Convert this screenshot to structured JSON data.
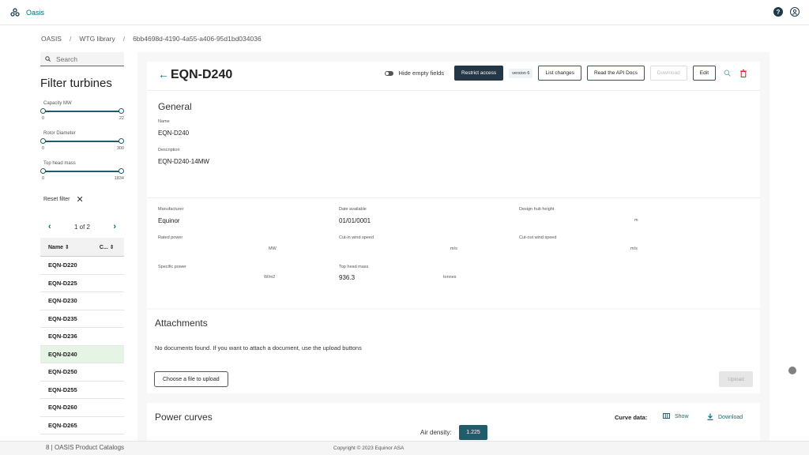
{
  "app": {
    "title": "Oasis"
  },
  "breadcrumb": [
    "OASIS",
    "WTG library",
    "6bb4698d-4190-4a55-a406-95d1bd034036"
  ],
  "breadcrumb_separator": "/",
  "sidebar": {
    "search_placeholder": "Search",
    "filter_title": "Filter turbines",
    "sliders": [
      {
        "label": "Capacity MW",
        "min": "0",
        "max": "22"
      },
      {
        "label": "Rotor Diameter",
        "min": "0",
        "max": "300"
      },
      {
        "label": "Top head mass",
        "min": "0",
        "max": "1834"
      }
    ],
    "reset_label": "Reset filter",
    "pager": "1 of 2",
    "columns": [
      "Name",
      "C..."
    ],
    "items": [
      "EQN-D220",
      "EQN-D225",
      "EQN-D230",
      "EQN-D235",
      "EQN-D236",
      "EQN-D240",
      "EQN-D250",
      "EQN-D255",
      "EQN-D260",
      "EQN-D265"
    ],
    "selected_item": "EQN-D240"
  },
  "detail": {
    "title": "EQN-D240",
    "hide_empty_label": "Hide empty fields",
    "restrict_access_label": "Restrict access",
    "version_label": "version 6",
    "list_changes_label": "List changes",
    "api_docs_label": "Read the API Docs",
    "download_label": "Download",
    "edit_label": "Edit",
    "general_title": "General",
    "name_label": "Name",
    "name_value": "EQN-D240",
    "description_label": "Description",
    "description_value": "EQN-D240-14MW",
    "fields": {
      "manufacturer_label": "Manufacturer",
      "manufacturer_value": "Equinor",
      "date_available_label": "Date available",
      "date_available_value": "01/01/0001",
      "design_hub_height_label": "Design hub height",
      "design_hub_height_unit": "m",
      "rated_power_label": "Rated power",
      "rated_power_unit": "MW",
      "cut_in_label": "Cut-in wind speed",
      "cut_in_unit": "m/s",
      "cut_out_label": "Cut-out wind speed",
      "cut_out_unit": "m/s",
      "specific_power_label": "Specific power",
      "specific_power_unit": "W/m2",
      "top_head_mass_label": "Top head mass",
      "top_head_mass_value": "936.3",
      "top_head_mass_unit": "tonnes"
    }
  },
  "attachments": {
    "title": "Attachments",
    "empty_message": "No documents found. If you want to attach a document, use the upload buttons",
    "choose_label": "Choose a file to upload",
    "upload_label": "Upload"
  },
  "power_curves": {
    "title": "Power curves",
    "curve_data_label": "Curve data:",
    "show_label": "Show",
    "download_label": "Download",
    "air_density_label": "Air density:",
    "air_density_value": "1.225"
  },
  "footer": {
    "left": "8 | OASIS Product Catalogs",
    "center": "Copyright © 2023 Equinor ASA"
  },
  "colors": {
    "accent": "#007079",
    "dark": "#243746",
    "selected_row": "#e6f4e6"
  }
}
